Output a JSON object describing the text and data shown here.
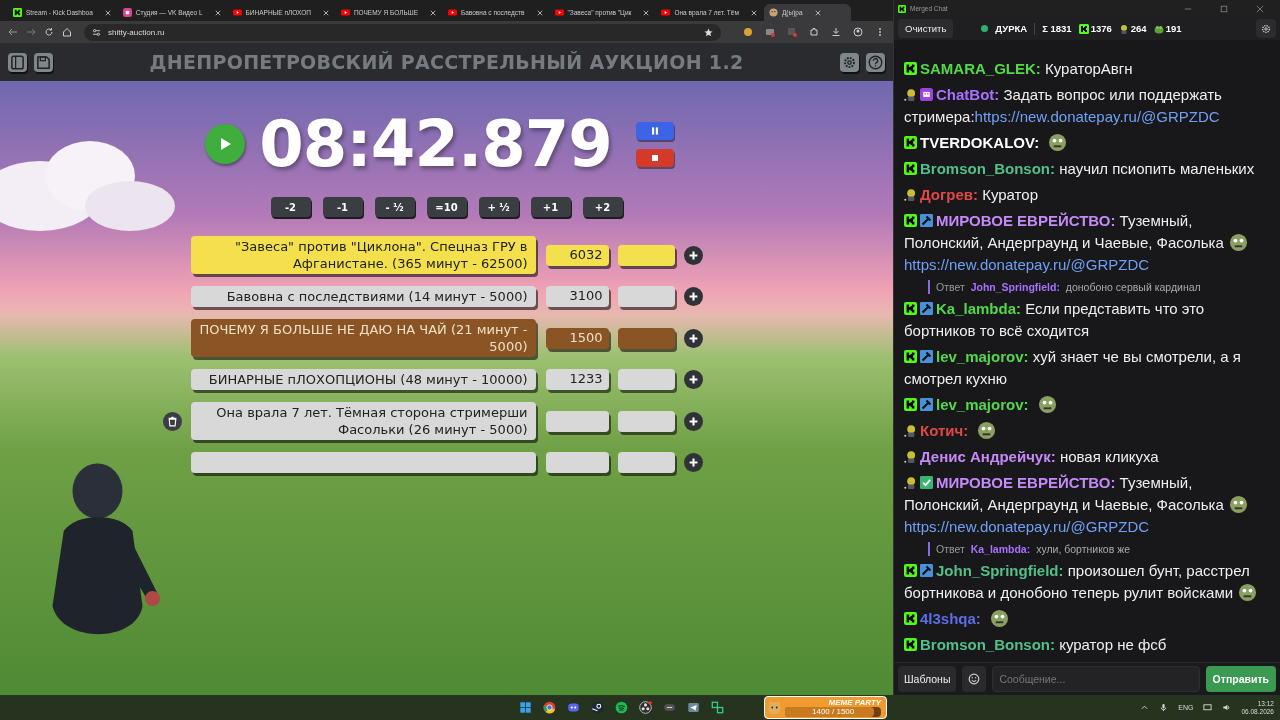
{
  "browser": {
    "tabs": [
      {
        "title": "Stream - Kick Dashboa",
        "kind": "kick",
        "selected": false
      },
      {
        "title": "Студия — VK Видео L",
        "kind": "vk",
        "selected": false
      },
      {
        "title": "БИНАРНЫЕ пЛОХОП",
        "kind": "youtube",
        "selected": false
      },
      {
        "title": "ПОЧЕМУ Я БОЛЬШЕ",
        "kind": "youtube",
        "selected": false
      },
      {
        "title": "Бавовна с последств",
        "kind": "youtube",
        "selected": false
      },
      {
        "title": "\"Завеса\" против \"Цик",
        "kind": "youtube",
        "selected": false
      },
      {
        "title": "Она врала 7 лет. Тём",
        "kind": "youtube",
        "selected": false
      },
      {
        "title": "Д(ы)ра",
        "kind": "page",
        "selected": true
      }
    ],
    "address": "shitty-auction.ru"
  },
  "auction": {
    "title": "ДНЕПРОПЕТРОВСКИЙ РАССТРЕЛЬНЫЙ АУКЦИОН 1.2",
    "timer": "08:42.879",
    "time_buttons": [
      "-2",
      "-1",
      "- ½",
      "=10",
      "+ ½",
      "+1",
      "+2"
    ],
    "lots": [
      {
        "kind": "filled",
        "name": "\"Завеса\" против \"Циклона\". Спецназ ГРУ в Афганистане. (365 минут - 62500)",
        "amount": "6032",
        "color": "#f4e04d",
        "show_delete": false
      },
      {
        "kind": "filled",
        "name": "Бавовна с последствиями (14 минут - 5000)",
        "amount": "3100",
        "color": "#d8d8d8",
        "show_delete": false
      },
      {
        "kind": "filled",
        "name": "ПОЧЕМУ Я БОЛЬШЕ НЕ ДАЮ НА ЧАЙ (21 минут - 5000)",
        "amount": "1500",
        "color": "#8a5424",
        "show_delete": false
      },
      {
        "kind": "filled",
        "name": "БИНАРНЫЕ пЛОХОПЦИОНЫ (48 минут - 10000)",
        "amount": "1233",
        "color": "#d8d8d8",
        "show_delete": false
      },
      {
        "kind": "filled",
        "name": "Она врала 7 лет. Тёмная сторона стримерши Фасольки (26 минут - 5000)",
        "color": "#d8d8d8",
        "show_delete": true
      },
      {
        "kind": "empty",
        "color": "#d8d8d8",
        "show_delete": false
      }
    ]
  },
  "chat": {
    "window_title": "Merged Chat",
    "clear_button": "Очистить",
    "channel": "ДУРКА",
    "stats": [
      {
        "kind": "sum",
        "text": "Σ 1831"
      },
      {
        "kind": "kick",
        "text": "1376"
      },
      {
        "kind": "avatar",
        "text": "264"
      },
      {
        "kind": "frog",
        "text": "191"
      }
    ],
    "messages": [
      {
        "kind": "message",
        "icons": [
          {
            "kind": "kick"
          }
        ],
        "user": "SAMARA_GLEK:",
        "color": "#53d84a",
        "text": "КураторАвгн"
      },
      {
        "kind": "message",
        "icons": [
          {
            "kind": "avatar"
          },
          {
            "kind": "bot"
          }
        ],
        "user": "ChatBot:",
        "color": "#a970ff",
        "text": "Задать вопрос или поддержать стримера:",
        "link": "https://new.donatepay.ru/@GRPZDC"
      },
      {
        "kind": "message",
        "icons": [
          {
            "kind": "kick"
          }
        ],
        "user": "TVERDOKALOV:",
        "color": "#ffffff",
        "emote": true
      },
      {
        "kind": "message",
        "icons": [
          {
            "kind": "kick"
          }
        ],
        "user": "Bromson_Bonson:",
        "color": "#53c08a",
        "text": "научил псиопить маленьких"
      },
      {
        "kind": "message",
        "icons": [
          {
            "kind": "avatar"
          }
        ],
        "user": "Догрев:",
        "color": "#e04848",
        "text": "Куратор"
      },
      {
        "kind": "message",
        "icons": [
          {
            "kind": "kick"
          },
          {
            "kind": "mod"
          }
        ],
        "user": "МИРОВОЕ ЕВРЕЙСТВО:",
        "color": "#c58af9",
        "text": "Туземный, Полонский, Андерграунд и Чаевые, Фасолька",
        "emote": true,
        "link": "https://new.donatepay.ru/@GRPZDC"
      },
      {
        "kind": "reply",
        "label": "Ответ",
        "user": "John_Springfield:",
        "color": "#a970ff",
        "text": "донобоно сервый кардинал"
      },
      {
        "kind": "message",
        "icons": [
          {
            "kind": "kick"
          },
          {
            "kind": "mod"
          }
        ],
        "user": "Ka_lambda:",
        "color": "#53d84a",
        "text": "Если представить что это бортников то всё сходится"
      },
      {
        "kind": "message",
        "icons": [
          {
            "kind": "kick"
          },
          {
            "kind": "mod"
          }
        ],
        "user": "lev_majorov:",
        "color": "#53d84a",
        "text": "хуй знает че вы смотрели, а я смотрел кухню"
      },
      {
        "kind": "message",
        "icons": [
          {
            "kind": "kick"
          },
          {
            "kind": "mod"
          }
        ],
        "user": "lev_majorov:",
        "color": "#53d84a",
        "emote": true
      },
      {
        "kind": "message",
        "icons": [
          {
            "kind": "avatar"
          }
        ],
        "user": "Котич:",
        "color": "#e04848",
        "emote": true
      },
      {
        "kind": "message",
        "icons": [
          {
            "kind": "avatar"
          }
        ],
        "user": "Денис Андрейчук:",
        "color": "#c58af9",
        "text": "новая кликуха"
      },
      {
        "kind": "message",
        "icons": [
          {
            "kind": "avatar"
          },
          {
            "kind": "check"
          }
        ],
        "user": "МИРОВОЕ ЕВРЕЙСТВО:",
        "color": "#c58af9",
        "text": "Туземный, Полонский, Андерграунд и Чаевые, Фасолька",
        "emote": true,
        "link": "https://new.donatepay.ru/@GRPZDC"
      },
      {
        "kind": "reply",
        "label": "Ответ",
        "user": "Ka_lambda:",
        "color": "#a970ff",
        "text": "хули, бортников же"
      },
      {
        "kind": "message",
        "icons": [
          {
            "kind": "kick"
          },
          {
            "kind": "mod"
          }
        ],
        "user": "John_Springfield:",
        "color": "#53c08a",
        "text": "произошел бунт, расстрел бортникова и донобоно теперь рулит войсками",
        "emote": true
      },
      {
        "kind": "message",
        "icons": [
          {
            "kind": "kick"
          }
        ],
        "user": "4l3shqa:",
        "color": "#5b6ee8",
        "emote": true
      },
      {
        "kind": "message",
        "icons": [
          {
            "kind": "kick"
          }
        ],
        "user": "Bromson_Bonson:",
        "color": "#53c08a",
        "text": "куратор не фсб"
      }
    ],
    "templates_button": "Шаблоны",
    "placeholder": "Сообщение...",
    "send_button": "Отправить"
  },
  "taskbar": {
    "widget": {
      "title": "MEME PARTY",
      "progress": "1400 / 1500",
      "level": 0.93
    },
    "language": "ENG",
    "time": "13:12",
    "date": "06.08.2026"
  }
}
